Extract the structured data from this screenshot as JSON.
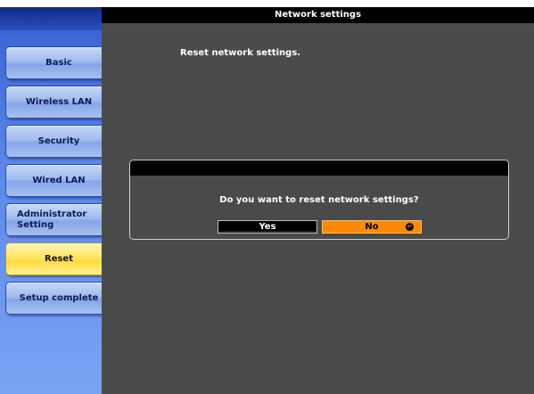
{
  "window": {
    "title": "Network settings"
  },
  "sidebar": {
    "items": [
      {
        "label": "Basic"
      },
      {
        "label": "Wireless LAN"
      },
      {
        "label": "Security"
      },
      {
        "label": "Wired LAN"
      },
      {
        "label": "Administrator\nSetting"
      },
      {
        "label": "Reset",
        "active": true
      },
      {
        "label": "Setup complete"
      }
    ]
  },
  "main": {
    "message": "Reset network settings."
  },
  "dialog": {
    "question": "Do you want to reset network settings?",
    "yes_label": "Yes",
    "no_label": "No",
    "enter_icon": "enter-icon",
    "enter_glyph": "↵"
  },
  "colors": {
    "accent_selected": "#ff8a00",
    "sidebar_active": "#ffe45a",
    "panel_bg": "#4b4b4b"
  }
}
